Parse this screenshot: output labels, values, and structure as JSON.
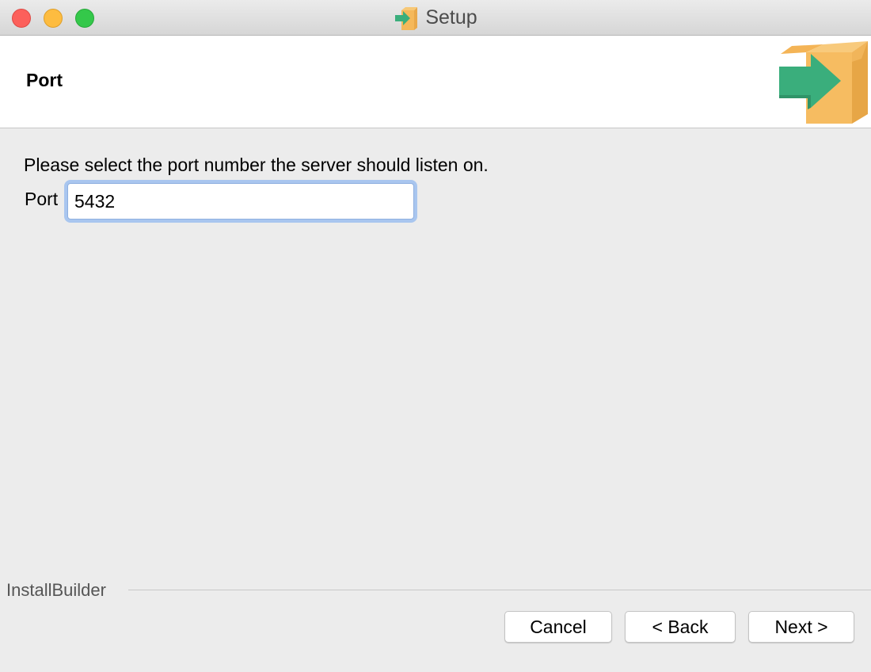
{
  "window": {
    "title": "Setup"
  },
  "header": {
    "title": "Port"
  },
  "main": {
    "instruction": "Please select the port number the server should listen on.",
    "port_label": "Port",
    "port_value": "5432"
  },
  "footer": {
    "brand": "InstallBuilder",
    "cancel_label": "Cancel",
    "back_label": "< Back",
    "next_label": "Next >"
  },
  "icons": {
    "title_icon": "installer-box-icon",
    "header_logo": "installer-box-icon"
  },
  "colors": {
    "box": "#f5b85a",
    "arrow": "#3aae7c",
    "focus_ring": "#a9c6ef"
  }
}
